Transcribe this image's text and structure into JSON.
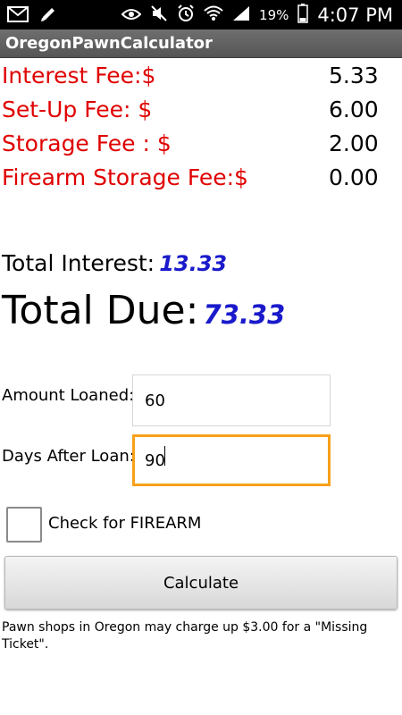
{
  "status_bar": {
    "battery_percent": "19%",
    "time": "4:07 PM",
    "icons": [
      "gmail-icon",
      "pencil-icon",
      "eye-icon",
      "mute-icon",
      "alarm-icon",
      "wifi-icon",
      "signal-icon",
      "battery-icon"
    ]
  },
  "app": {
    "title": "OregonPawnCalculator"
  },
  "fees": [
    {
      "label": "Interest Fee:$",
      "value": "5.33"
    },
    {
      "label": "Set-Up Fee: $",
      "value": "6.00"
    },
    {
      "label": "Storage Fee : $",
      "value": "2.00"
    },
    {
      "label": "Firearm Storage Fee:$",
      "value": "0.00"
    }
  ],
  "totals": {
    "interest_label": "Total Interest:",
    "interest_value": "13.33",
    "due_label": "Total Due:",
    "due_value": "73.33"
  },
  "form": {
    "amount_label": "Amount Loaned:",
    "amount_value": "60",
    "days_label": "Days After Loan:",
    "days_value": "90",
    "firearm_label": "Check for FIREARM",
    "firearm_checked": false,
    "calculate_label": "Calculate"
  },
  "note": "Pawn shops in Oregon may charge up $3.00 for a \"Missing Ticket\".",
  "colors": {
    "fee_label": "#e00000",
    "total_value": "#1a1acc",
    "focus_border": "#f7a01a"
  }
}
